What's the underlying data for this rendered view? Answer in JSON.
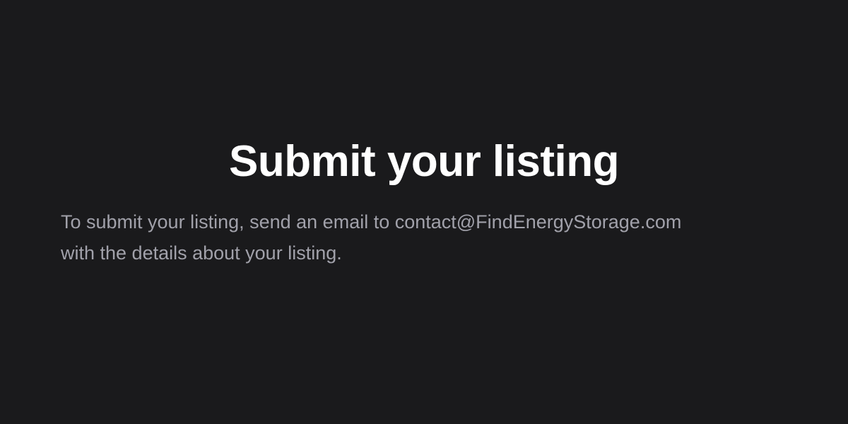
{
  "heading": {
    "title": "Submit your listing"
  },
  "body": {
    "line_1": "To submit your listing, send an email to contact@FindEnergyStorage.com",
    "line_2": "with the details about your listing."
  },
  "colors": {
    "background": "#1a1a1c",
    "title": "#ffffff",
    "text": "#a1a1aa"
  }
}
